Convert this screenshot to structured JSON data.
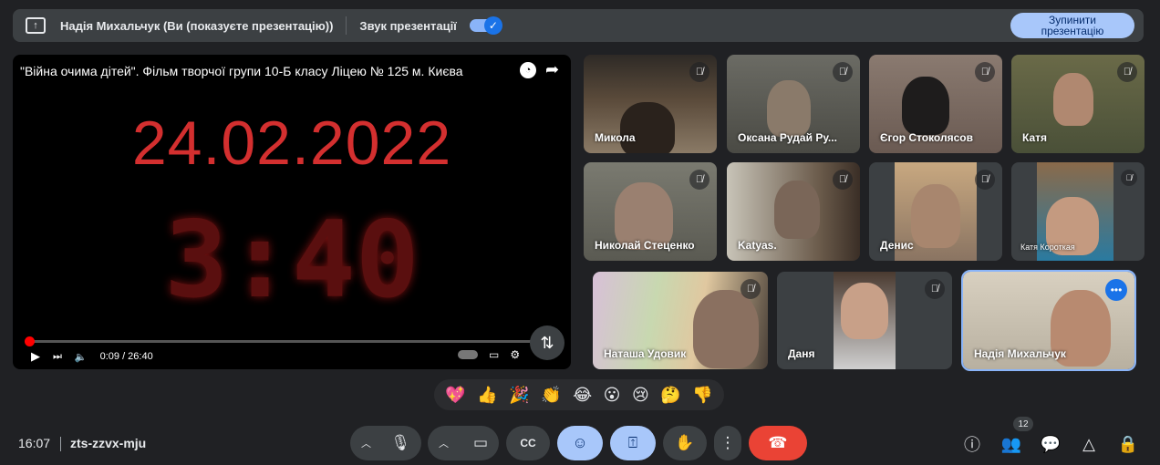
{
  "banner": {
    "presenter_text": "Надія Михальчук (Ви (показуєте презентацію))",
    "sound_label": "Звук презентації",
    "stop_button": "Зупинити презентацію"
  },
  "video": {
    "title": "\"Війна очима дітей\". Фільм творчої групи 10-Б класу Ліцею № 125 м. Києва",
    "date_text": "24.02.2022",
    "timer_text": "3:40",
    "time_display": "0:09 / 26:40",
    "progress": 0.006
  },
  "participants": [
    {
      "name": "Микола"
    },
    {
      "name": "Оксана Рудай Ру..."
    },
    {
      "name": "Єгор Стоколясов"
    },
    {
      "name": "Катя"
    },
    {
      "name": "Николай Стеценко"
    },
    {
      "name": "Katyas."
    },
    {
      "name": "Денис"
    },
    {
      "name": "Катя Короткая"
    },
    {
      "name": "Наташа Удовик"
    },
    {
      "name": "Даня"
    },
    {
      "name": "Надія Михальчук"
    }
  ],
  "reactions": [
    "💖",
    "👍",
    "🎉",
    "👏",
    "😂",
    "😮",
    "😢",
    "🤔",
    "👎"
  ],
  "bottom": {
    "time": "16:07",
    "meeting_code": "zts-zzvx-mju",
    "people_count": "12"
  },
  "colors": {
    "accent": "#8ab4f8",
    "end_call": "#ea4335",
    "date_red": "#d32f2f"
  }
}
